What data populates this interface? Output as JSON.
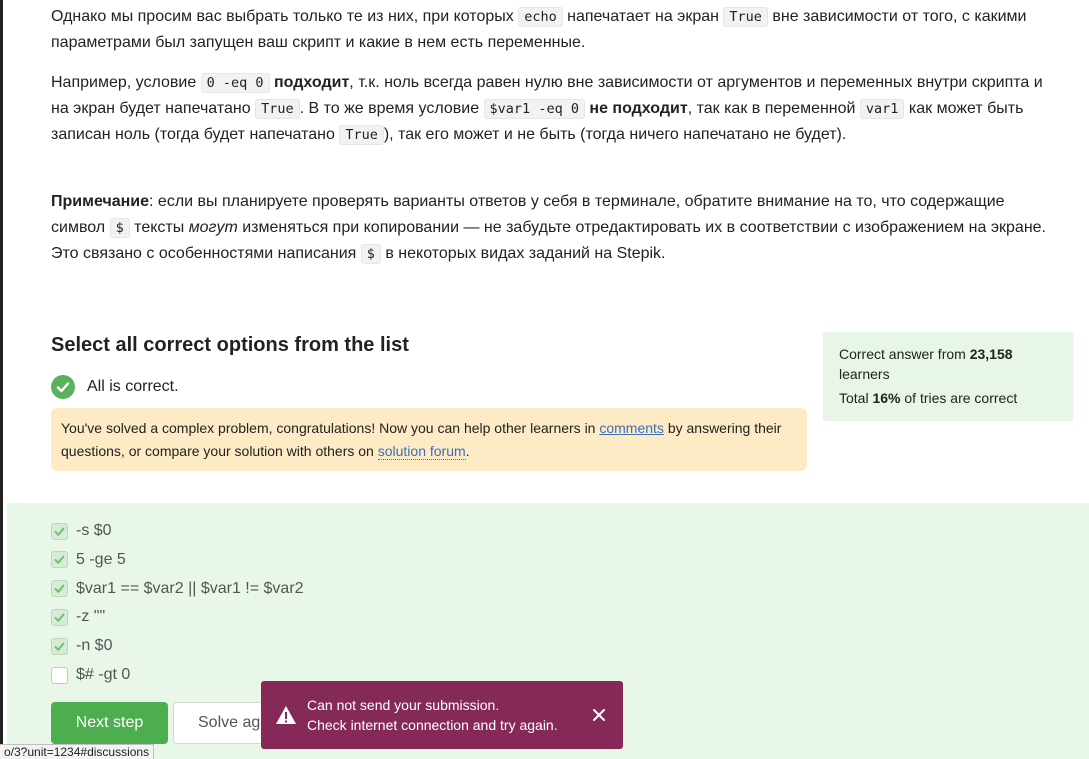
{
  "intro": {
    "p1": {
      "t1": "Однако мы просим вас выбрать только те из них, при которых ",
      "c1": "echo",
      "t2": " напечатает на экран ",
      "c2": "True",
      "t3": " вне зависимости от того, с какими параметрами был запущен ваш скрипт и какие в нем есть переменные."
    },
    "p2": {
      "t1": "Например, условие ",
      "c1": "0 -eq 0",
      "b1": "подходит",
      "t2": ", т.к. ноль всегда равен нулю вне зависимости от аргументов и переменных внутри скрипта и на экран будет напечатано ",
      "c2": "True",
      "t3": ". В то же время условие ",
      "c3": "$var1 -eq 0",
      "b2": "не подходит",
      "t4": ", так как в переменной ",
      "c4": "var1",
      "t5": " как может быть записан ноль (тогда будет напечатано ",
      "c5": "True",
      "t6": "), так его может и не быть (тогда ничего напечатано не будет)."
    },
    "p3": {
      "b1": "Примечание",
      "t1": ": если вы планируете проверять варианты ответов у себя в терминале, обратите внимание на то, что содержащие символ ",
      "c1": "$",
      "t2": " тексты ",
      "i1": "могут",
      "t3": " изменяться при копировании — не забудьте отредактировать их в соответствии с изображением на экране. Это связано с особенностями написания ",
      "c2": "$",
      "t4": " в некоторых видах заданий на Stepik."
    }
  },
  "question": {
    "title": "Select all correct options from the list",
    "result": "All is correct."
  },
  "notice": {
    "t1": "You've solved a complex problem, congratulations! Now you can help other learners in ",
    "link1": "comments",
    "t2": " by answering their questions, or compare your solution with others on ",
    "link2": "solution forum",
    "t3": "."
  },
  "stats": {
    "t1": "Correct answer from ",
    "count": "23,158",
    "t2": " learners",
    "t3": "Total ",
    "percent": "16%",
    "t4": " of tries are correct"
  },
  "options": [
    {
      "label": "-s $0",
      "checked": true
    },
    {
      "label": "5 -ge 5",
      "checked": true
    },
    {
      "label": "$var1 == $var2 || $var1 != $var2",
      "checked": true
    },
    {
      "label": "-z \"\"",
      "checked": true
    },
    {
      "label": "-n $0",
      "checked": true
    },
    {
      "label": "$# -gt 0",
      "checked": false
    }
  ],
  "buttons": {
    "next": "Next step",
    "solve": "Solve again"
  },
  "toast": {
    "line1": "Can not send your submission.",
    "line2": "Check internet connection and try again."
  },
  "statusbar": "o/3?unit=1234#discussions",
  "colors": {
    "success": "#4cae4f",
    "notice_bg": "#fdebc5",
    "stats_bg": "#e7f6e7",
    "toast_bg": "#852a58",
    "link": "#3b6fb6"
  }
}
